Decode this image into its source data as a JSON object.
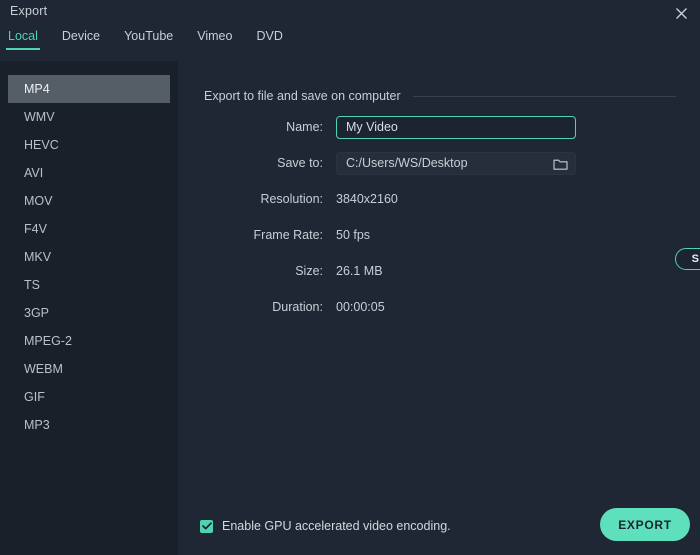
{
  "window": {
    "title": "Export",
    "close_icon": "close-icon"
  },
  "tabs": [
    {
      "label": "Local",
      "active": true
    },
    {
      "label": "Device",
      "active": false
    },
    {
      "label": "YouTube",
      "active": false
    },
    {
      "label": "Vimeo",
      "active": false
    },
    {
      "label": "DVD",
      "active": false
    }
  ],
  "sidebar": {
    "formats": [
      {
        "label": "MP4",
        "selected": true
      },
      {
        "label": "WMV",
        "selected": false
      },
      {
        "label": "HEVC",
        "selected": false
      },
      {
        "label": "AVI",
        "selected": false
      },
      {
        "label": "MOV",
        "selected": false
      },
      {
        "label": "F4V",
        "selected": false
      },
      {
        "label": "MKV",
        "selected": false
      },
      {
        "label": "TS",
        "selected": false
      },
      {
        "label": "3GP",
        "selected": false
      },
      {
        "label": "MPEG-2",
        "selected": false
      },
      {
        "label": "WEBM",
        "selected": false
      },
      {
        "label": "GIF",
        "selected": false
      },
      {
        "label": "MP3",
        "selected": false
      }
    ]
  },
  "main": {
    "section_title": "Export to file and save on computer",
    "fields": {
      "name_label": "Name:",
      "name_value": "My Video",
      "name_placeholder": "My Video",
      "saveto_label": "Save to:",
      "saveto_value": "C:/Users/WS/Desktop",
      "folder_icon": "folder-icon",
      "resolution_label": "Resolution:",
      "resolution_value": "3840x2160",
      "settings_button": "SETTINGS",
      "framerate_label": "Frame Rate:",
      "framerate_value": "50 fps",
      "size_label": "Size:",
      "size_value": "26.1 MB",
      "duration_label": "Duration:",
      "duration_value": "00:00:05"
    }
  },
  "footer": {
    "gpu_label": "Enable GPU accelerated video encoding.",
    "gpu_checked": true,
    "export_button": "EXPORT"
  },
  "colors": {
    "accent": "#4fd4b0",
    "accent_button": "#5ee0bc",
    "background": "#1e2733",
    "sidebar_background": "#1a2029",
    "selected_row": "#555e67",
    "text": "#c9ced6"
  }
}
